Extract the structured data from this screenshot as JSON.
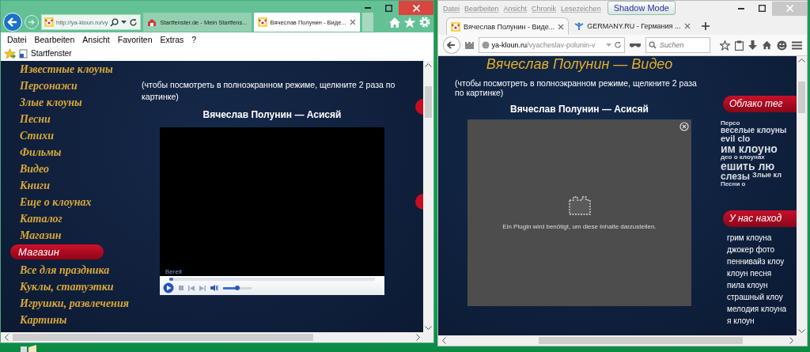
{
  "ie": {
    "address": "http://ya-kloun.ru/vy",
    "tabs": [
      {
        "title": "Startfenster.de - Mein Startfens...",
        "selected": false
      },
      {
        "title": "Вячеслав Полунин - Виде...",
        "selected": true
      }
    ],
    "menu": [
      "Datei",
      "Bearbeiten",
      "Ansicht",
      "Favoriten",
      "Extras",
      "?"
    ],
    "favorites": [
      "Startfenster"
    ],
    "page": {
      "nav": [
        {
          "label": "Известные клоуны",
          "kind": "link"
        },
        {
          "label": "Персонажи",
          "kind": "link"
        },
        {
          "label": "Злые клоуны",
          "kind": "link"
        },
        {
          "label": "Песни",
          "kind": "link"
        },
        {
          "label": "Стихи",
          "kind": "link"
        },
        {
          "label": "Фильмы",
          "kind": "link"
        },
        {
          "label": "Видео",
          "kind": "link"
        },
        {
          "label": "Книги",
          "kind": "link"
        },
        {
          "label": "Еще о клоунах",
          "kind": "link"
        },
        {
          "label": "Каталог",
          "kind": "link"
        },
        {
          "label": "Магазин",
          "kind": "link"
        },
        {
          "label": "Магазин",
          "kind": "header"
        },
        {
          "label": "Все для праздника",
          "kind": "link"
        },
        {
          "label": "Куклы, статуэтки",
          "kind": "link"
        },
        {
          "label": "Игрушки, развлечения",
          "kind": "link"
        },
        {
          "label": "Картины",
          "kind": "link"
        }
      ],
      "hint": "(чтобы посмотреть в полноэкранном режиме, щелкните 2 раза по картинке)",
      "video_title": "Вячеслав Полунин — Асисяй",
      "player": {
        "status": "Bereit",
        "seek": {
          "level": 0.02
        },
        "volume": {
          "level": 0.5
        }
      }
    }
  },
  "firefox": {
    "menu": [
      "Datei",
      "Bearbeiten",
      "Ansicht",
      "Chronik",
      "Lesezeichen"
    ],
    "badge": "Shadow Mode",
    "tabs": [
      {
        "title": "Вячеслав Полунин - Виде...",
        "selected": true
      },
      {
        "title": "GERMANY.RU - Германия ...",
        "selected": false
      }
    ],
    "address_host": "ya-kloun.ru",
    "address_path": "/vyacheslav-polunin-v",
    "search": {
      "placeholder": "Suchen"
    },
    "page": {
      "heading": "Вячеслав Полунин — Видео",
      "hint": "(чтобы посмотреть в полноэкранном режиме, щелкните 2 раза по картинке)",
      "video_title": "Вячеслав Полунин — Асисяй",
      "plugin_message": "Ein Plugin wird benötigt, um diese Inhalte darzustellen.",
      "sidebar": [
        {
          "title": "Облако тег",
          "kind": "cloud",
          "items": [
            "Персо",
            "веселые клоуны",
            "evil clo",
            "им клоуно",
            "део о клоунах",
            "ешить лю",
            "слезы",
            "Злые кл",
            "Песни о"
          ]
        },
        {
          "title": "У нас наход",
          "kind": "list",
          "items": [
            "грим клоуна",
            "джокер фото",
            "пеннивайз клоу",
            "клоун песня",
            "пила клоун",
            "страшный клоу",
            "мелодия клоуна",
            "я клоун"
          ]
        }
      ]
    }
  }
}
